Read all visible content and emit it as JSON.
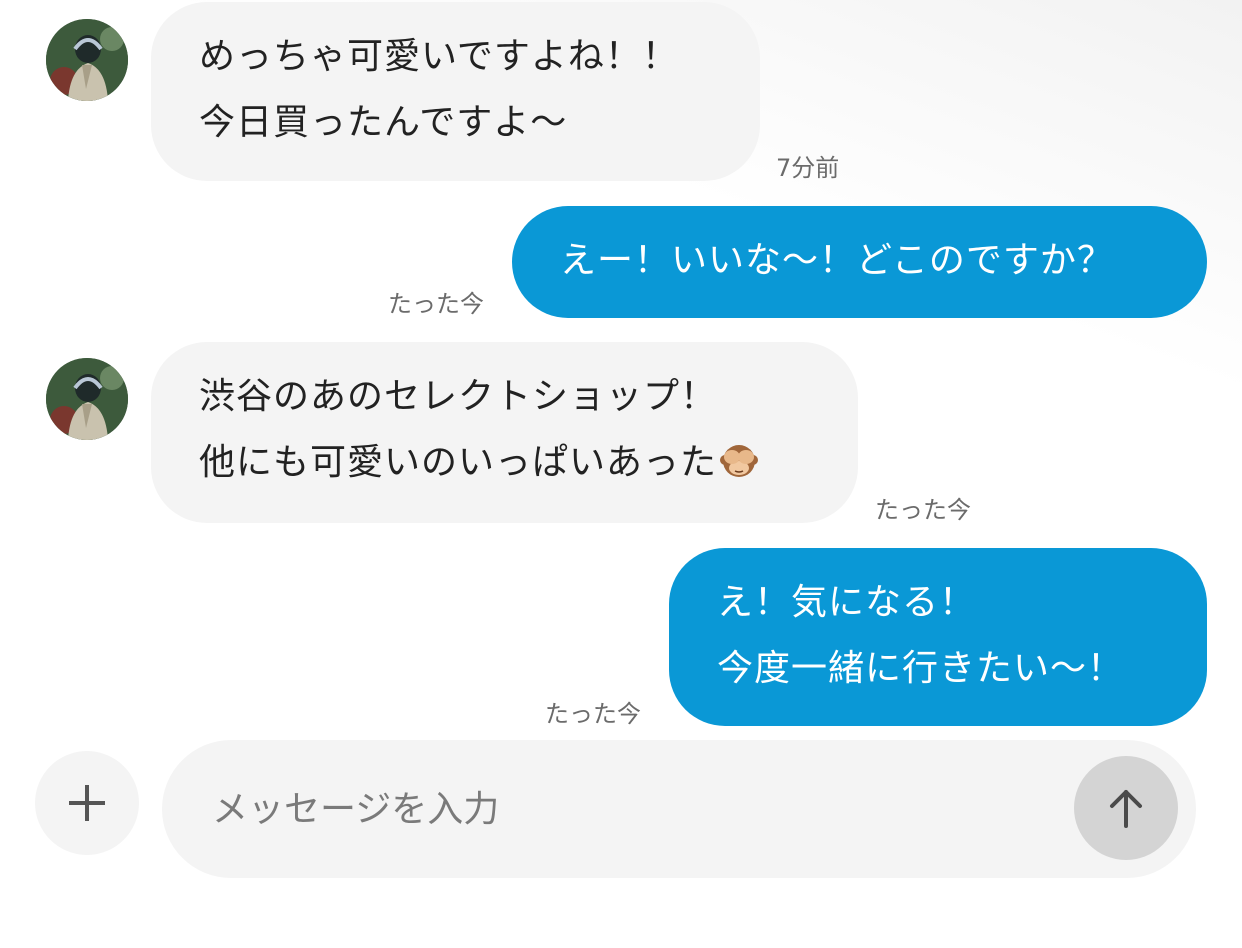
{
  "messages": [
    {
      "direction": "incoming",
      "lines": [
        "めっちゃ可愛いですよね！！",
        "今日買ったんですよ〜"
      ],
      "time": "7分前"
    },
    {
      "direction": "outgoing",
      "lines": [
        "えー！いいな〜！どこのですか？"
      ],
      "time": "たった今"
    },
    {
      "direction": "incoming",
      "lines": [
        "渋谷のあのセレクトショップ！",
        "他にも可愛いのいっぱいあった"
      ],
      "emoji": "see-no-evil-monkey",
      "time": "たった今"
    },
    {
      "direction": "outgoing",
      "lines": [
        "え！気になる！",
        "今度一緒に行きたい〜！"
      ],
      "time": "たった今"
    }
  ],
  "composer": {
    "placeholder": "メッセージを入力",
    "value": "",
    "plus_icon": "plus-icon",
    "send_icon": "arrow-up-icon"
  },
  "colors": {
    "outgoing_bubble": "#0a98d6",
    "incoming_bubble": "#f4f4f4",
    "timestamp": "#6b6b6b",
    "send_button": "#d4d4d4"
  }
}
